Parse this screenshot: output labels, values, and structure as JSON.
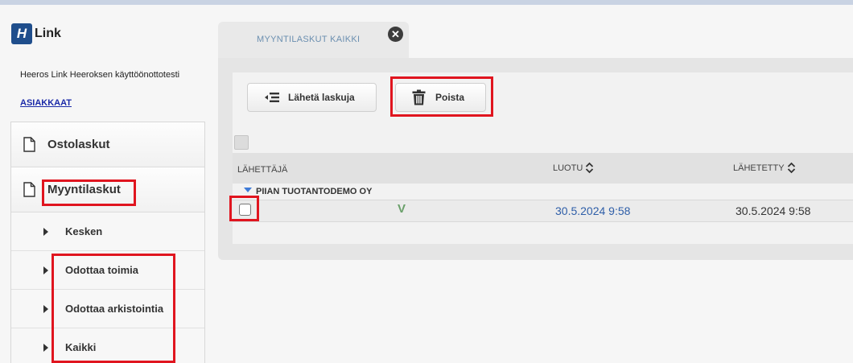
{
  "app": {
    "logo_mark": "H",
    "logo_text": "Link"
  },
  "sidebar": {
    "company": "Heeros Link Heeroksen käyttöönottotesti",
    "customers_link": "ASIAKKAAT",
    "main_items": [
      {
        "label": "Ostolaskut",
        "icon": "document-icon"
      },
      {
        "label": "Myyntilaskut",
        "icon": "document-icon"
      }
    ],
    "sub_items": [
      {
        "label": "Kesken"
      },
      {
        "label": "Odottaa toimia"
      },
      {
        "label": "Odottaa arkistointia"
      },
      {
        "label": "Kaikki"
      }
    ]
  },
  "tab": {
    "label": "MYYNTILASKUT KAIKKI",
    "close_glyph": "✕"
  },
  "toolbar": {
    "send_label": "Lähetä laskuja",
    "delete_label": "Poista"
  },
  "table": {
    "headers": {
      "sender": "LÄHETTÄJÄ",
      "created": "LUOTU",
      "sent": "LÄHETETTY"
    },
    "group": "PIIAN TUOTANTODEMO OY",
    "rows": [
      {
        "mark": "V",
        "created": "30.5.2024 9:58",
        "sent": "30.5.2024 9:58"
      }
    ]
  },
  "colors": {
    "accent": "#1f4e8c",
    "link": "#2e5ea8",
    "highlight": "#e0151f"
  }
}
